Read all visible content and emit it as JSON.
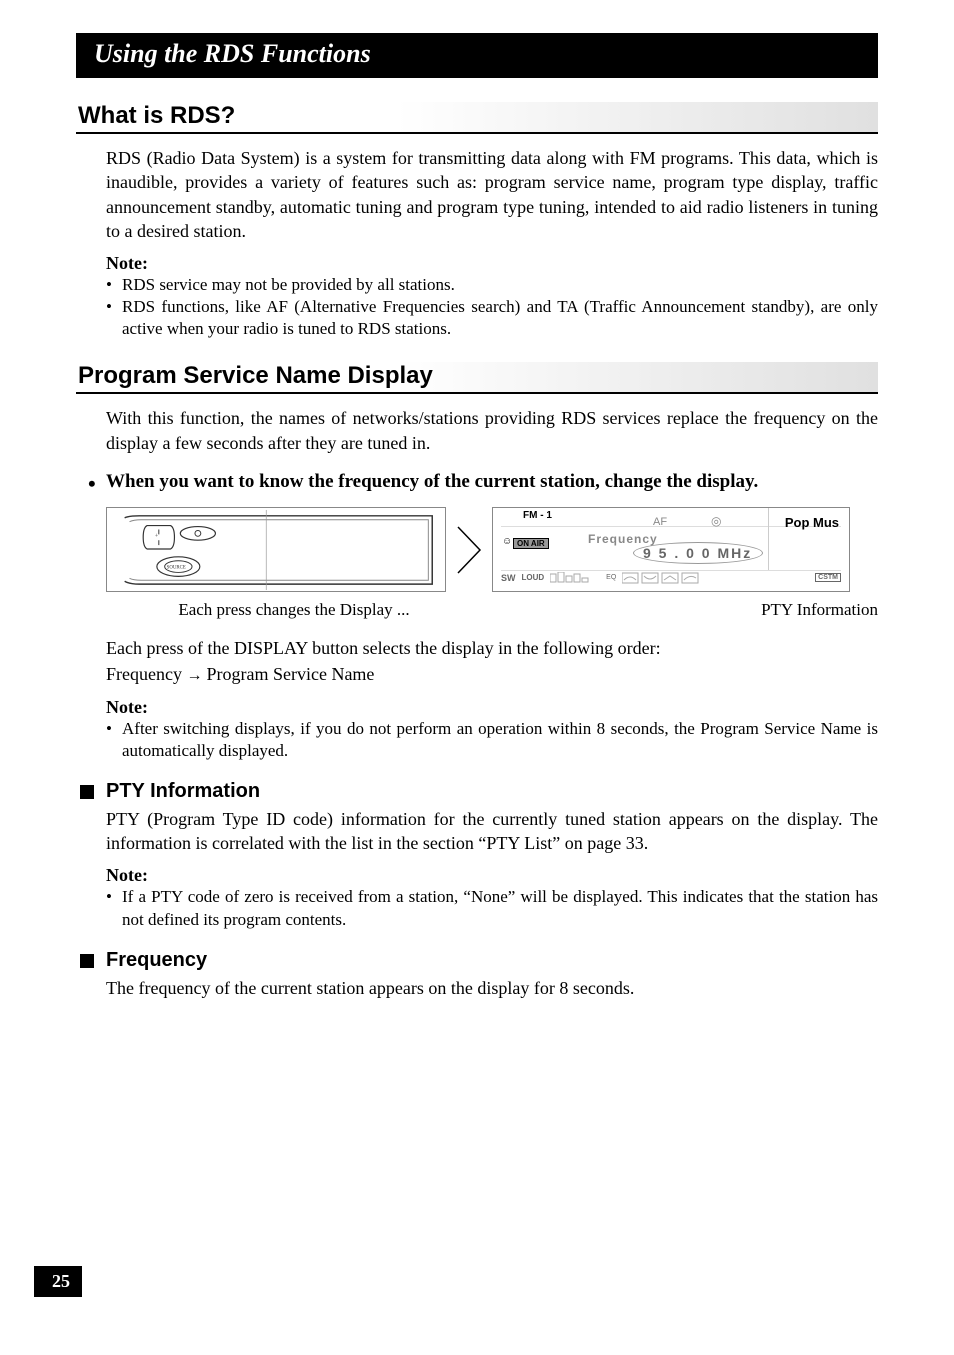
{
  "chapter_title": "Using the RDS Functions",
  "section1": {
    "heading": "What is RDS?",
    "paragraph": "RDS (Radio Data System) is a system for transmitting data along with FM programs. This data, which is inaudible, provides a variety of features such as: program service name, program type display, traffic announcement standby, automatic tuning and program type tuning, intended to aid radio listeners in tuning to a desired station.",
    "note_label": "Note:",
    "notes": [
      "RDS service may not be provided by all stations.",
      "RDS functions, like AF (Alternative Frequencies search) and TA (Traffic Announcement standby), are only active when your radio is tuned to RDS stations."
    ]
  },
  "section2": {
    "heading": "Program Service Name Display",
    "paragraph": "With this function, the names of networks/stations providing RDS services replace the frequency on the display a few seconds after they are tuned in.",
    "bullet": "When you want to know the frequency of the current station, change the display.",
    "caption_left": "Each press changes the Display ...",
    "caption_right": "PTY Information",
    "order_intro": "Each press of the DISPLAY button selects the display in the following order:",
    "order_a": "Frequency",
    "order_b": "Program Service Name",
    "note_label": "Note:",
    "notes": [
      "After switching displays, if you do not perform an operation within 8 seconds, the Program Service Name is automatically displayed."
    ]
  },
  "subsection_pty": {
    "heading": "PTY Information",
    "paragraph": "PTY (Program Type ID code) information for the currently tuned station appears on the display. The information is correlated with the list in the section “PTY List” on page 33.",
    "note_label": "Note:",
    "notes": [
      "If a PTY code of zero is received from a station, “None” will be displayed. This indicates that the station has not defined its program contents."
    ]
  },
  "subsection_freq": {
    "heading": "Frequency",
    "paragraph": "The frequency of the current station appears on the display for 8 seconds."
  },
  "display": {
    "fm": "FM - 1",
    "af": "AF",
    "pop": "Pop Mus",
    "onair": "ON AIR",
    "freq_label": "Frequency",
    "freq_value": "9 5 . 0 0 MHz",
    "sw": "SW",
    "loud": "LOUD",
    "eq": "EQ",
    "cstm": "CSTM"
  },
  "page_number": "25"
}
